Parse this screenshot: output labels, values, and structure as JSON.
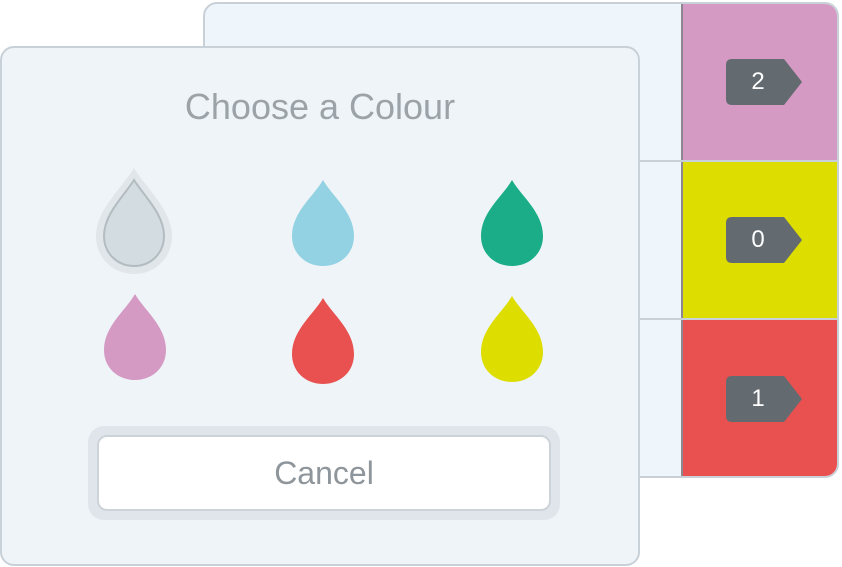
{
  "colors": {
    "pink": "#d49ac4",
    "yellow": "#dddd00",
    "red": "#e8514f",
    "tag": "#636a70",
    "grey_swatch": "#d3dce1",
    "blue_swatch": "#92d2e2",
    "green_swatch": "#1bad88"
  },
  "rows": [
    {
      "count": "2",
      "color": "pink"
    },
    {
      "count": "0",
      "color": "yellow"
    },
    {
      "count": "1",
      "color": "red"
    }
  ],
  "dialog": {
    "title": "Choose a Colour",
    "swatches": [
      {
        "name": "grey",
        "color": "#d3dce1",
        "selected": true
      },
      {
        "name": "blue",
        "color": "#92d2e2",
        "selected": false
      },
      {
        "name": "green",
        "color": "#1bad88",
        "selected": false
      },
      {
        "name": "pink",
        "color": "#d49ac4",
        "selected": false
      },
      {
        "name": "red",
        "color": "#e8514f",
        "selected": false
      },
      {
        "name": "yellow",
        "color": "#dddd00",
        "selected": false
      }
    ],
    "cancel_label": "Cancel"
  }
}
